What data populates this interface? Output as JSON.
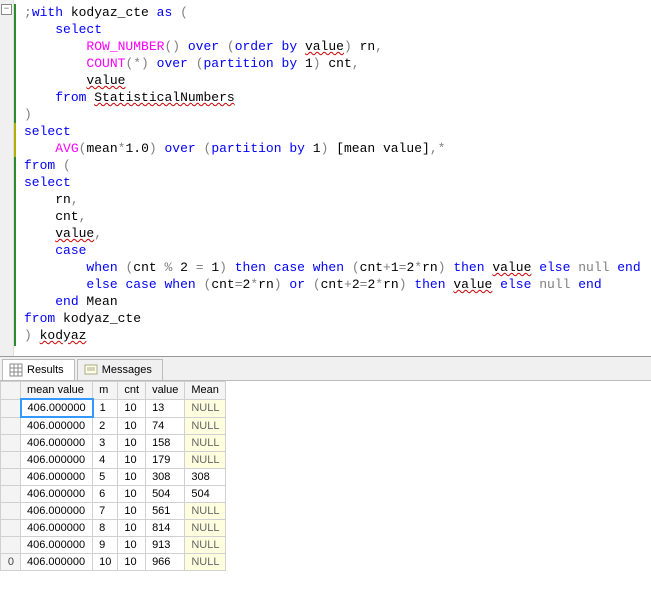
{
  "editor": {
    "lines": [
      [
        {
          "t": ";",
          "c": "grey"
        },
        {
          "t": "with",
          "c": "kw"
        },
        {
          "t": " kodyaz_cte ",
          "c": "ident"
        },
        {
          "t": "as",
          "c": "kw"
        },
        {
          "t": " ",
          "c": "ident"
        },
        {
          "t": "(",
          "c": "grey"
        }
      ],
      [
        {
          "t": "    ",
          "c": ""
        },
        {
          "t": "select",
          "c": "kw"
        }
      ],
      [
        {
          "t": "        ",
          "c": ""
        },
        {
          "t": "ROW_NUMBER",
          "c": "func"
        },
        {
          "t": "() ",
          "c": "grey"
        },
        {
          "t": "over",
          "c": "kw"
        },
        {
          "t": " ",
          "c": ""
        },
        {
          "t": "(",
          "c": "grey"
        },
        {
          "t": "order",
          "c": "kw"
        },
        {
          "t": " ",
          "c": ""
        },
        {
          "t": "by",
          "c": "kw"
        },
        {
          "t": " ",
          "c": ""
        },
        {
          "t": "value",
          "c": "ident squig"
        },
        {
          "t": ")",
          "c": "grey"
        },
        {
          "t": " rn",
          "c": "ident"
        },
        {
          "t": ",",
          "c": "grey"
        }
      ],
      [
        {
          "t": "        ",
          "c": ""
        },
        {
          "t": "COUNT",
          "c": "func"
        },
        {
          "t": "(*) ",
          "c": "grey"
        },
        {
          "t": "over",
          "c": "kw"
        },
        {
          "t": " ",
          "c": ""
        },
        {
          "t": "(",
          "c": "grey"
        },
        {
          "t": "partition",
          "c": "kw"
        },
        {
          "t": " ",
          "c": ""
        },
        {
          "t": "by",
          "c": "kw"
        },
        {
          "t": " 1",
          "c": "num"
        },
        {
          "t": ")",
          "c": "grey"
        },
        {
          "t": " cnt",
          "c": "ident"
        },
        {
          "t": ",",
          "c": "grey"
        }
      ],
      [
        {
          "t": "        ",
          "c": ""
        },
        {
          "t": "value",
          "c": "ident squig"
        }
      ],
      [
        {
          "t": "    ",
          "c": ""
        },
        {
          "t": "from",
          "c": "kw"
        },
        {
          "t": " ",
          "c": ""
        },
        {
          "t": "StatisticalNumbers",
          "c": "ident squig"
        }
      ],
      [
        {
          "t": ")",
          "c": "grey"
        }
      ],
      [
        {
          "t": "select",
          "c": "kw"
        }
      ],
      [
        {
          "t": "    ",
          "c": ""
        },
        {
          "t": "AVG",
          "c": "func"
        },
        {
          "t": "(",
          "c": "grey"
        },
        {
          "t": "mean",
          "c": "ident"
        },
        {
          "t": "*",
          "c": "grey"
        },
        {
          "t": "1.0",
          "c": "num"
        },
        {
          "t": ") ",
          "c": "grey"
        },
        {
          "t": "over",
          "c": "kw"
        },
        {
          "t": " ",
          "c": ""
        },
        {
          "t": "(",
          "c": "grey"
        },
        {
          "t": "partition",
          "c": "kw"
        },
        {
          "t": " ",
          "c": ""
        },
        {
          "t": "by",
          "c": "kw"
        },
        {
          "t": " 1",
          "c": "num"
        },
        {
          "t": ")",
          "c": "grey"
        },
        {
          "t": " [mean value]",
          "c": "ident"
        },
        {
          "t": ",*",
          "c": "grey"
        }
      ],
      [
        {
          "t": "from",
          "c": "kw"
        },
        {
          "t": " ",
          "c": ""
        },
        {
          "t": "(",
          "c": "grey"
        }
      ],
      [
        {
          "t": "select",
          "c": "kw"
        }
      ],
      [
        {
          "t": "    rn",
          "c": "ident"
        },
        {
          "t": ",",
          "c": "grey"
        }
      ],
      [
        {
          "t": "    cnt",
          "c": "ident"
        },
        {
          "t": ",",
          "c": "grey"
        }
      ],
      [
        {
          "t": "    ",
          "c": ""
        },
        {
          "t": "value",
          "c": "ident squig"
        },
        {
          "t": ",",
          "c": "grey"
        }
      ],
      [
        {
          "t": "    ",
          "c": ""
        },
        {
          "t": "case",
          "c": "kw"
        }
      ],
      [
        {
          "t": "        ",
          "c": ""
        },
        {
          "t": "when",
          "c": "kw"
        },
        {
          "t": " ",
          "c": ""
        },
        {
          "t": "(",
          "c": "grey"
        },
        {
          "t": "cnt ",
          "c": "ident"
        },
        {
          "t": "%",
          "c": "grey"
        },
        {
          "t": " 2 ",
          "c": "num"
        },
        {
          "t": "=",
          "c": "grey"
        },
        {
          "t": " 1",
          "c": "num"
        },
        {
          "t": ") ",
          "c": "grey"
        },
        {
          "t": "then",
          "c": "kw"
        },
        {
          "t": " ",
          "c": ""
        },
        {
          "t": "case",
          "c": "kw"
        },
        {
          "t": " ",
          "c": ""
        },
        {
          "t": "when",
          "c": "kw"
        },
        {
          "t": " ",
          "c": ""
        },
        {
          "t": "(",
          "c": "grey"
        },
        {
          "t": "cnt",
          "c": "ident"
        },
        {
          "t": "+",
          "c": "grey"
        },
        {
          "t": "1",
          "c": "num"
        },
        {
          "t": "=",
          "c": "grey"
        },
        {
          "t": "2",
          "c": "num"
        },
        {
          "t": "*",
          "c": "grey"
        },
        {
          "t": "rn",
          "c": "ident"
        },
        {
          "t": ") ",
          "c": "grey"
        },
        {
          "t": "then",
          "c": "kw"
        },
        {
          "t": " ",
          "c": ""
        },
        {
          "t": "value",
          "c": "ident squig"
        },
        {
          "t": " ",
          "c": ""
        },
        {
          "t": "else",
          "c": "kw"
        },
        {
          "t": " ",
          "c": ""
        },
        {
          "t": "null",
          "c": "grey"
        },
        {
          "t": " ",
          "c": ""
        },
        {
          "t": "end",
          "c": "kw"
        }
      ],
      [
        {
          "t": "        ",
          "c": ""
        },
        {
          "t": "else",
          "c": "kw"
        },
        {
          "t": " ",
          "c": ""
        },
        {
          "t": "case",
          "c": "kw"
        },
        {
          "t": " ",
          "c": ""
        },
        {
          "t": "when",
          "c": "kw"
        },
        {
          "t": " ",
          "c": ""
        },
        {
          "t": "(",
          "c": "grey"
        },
        {
          "t": "cnt",
          "c": "ident"
        },
        {
          "t": "=",
          "c": "grey"
        },
        {
          "t": "2",
          "c": "num"
        },
        {
          "t": "*",
          "c": "grey"
        },
        {
          "t": "rn",
          "c": "ident"
        },
        {
          "t": ") ",
          "c": "grey"
        },
        {
          "t": "or",
          "c": "kw"
        },
        {
          "t": " ",
          "c": ""
        },
        {
          "t": "(",
          "c": "grey"
        },
        {
          "t": "cnt",
          "c": "ident"
        },
        {
          "t": "+",
          "c": "grey"
        },
        {
          "t": "2",
          "c": "num"
        },
        {
          "t": "=",
          "c": "grey"
        },
        {
          "t": "2",
          "c": "num"
        },
        {
          "t": "*",
          "c": "grey"
        },
        {
          "t": "rn",
          "c": "ident"
        },
        {
          "t": ") ",
          "c": "grey"
        },
        {
          "t": "then",
          "c": "kw"
        },
        {
          "t": " ",
          "c": ""
        },
        {
          "t": "value",
          "c": "ident squig"
        },
        {
          "t": " ",
          "c": ""
        },
        {
          "t": "else",
          "c": "kw"
        },
        {
          "t": " ",
          "c": ""
        },
        {
          "t": "null",
          "c": "grey"
        },
        {
          "t": " ",
          "c": ""
        },
        {
          "t": "end",
          "c": "kw"
        }
      ],
      [
        {
          "t": "    ",
          "c": ""
        },
        {
          "t": "end",
          "c": "kw"
        },
        {
          "t": " Mean",
          "c": "ident"
        }
      ],
      [
        {
          "t": "from",
          "c": "kw"
        },
        {
          "t": " kodyaz_cte",
          "c": "ident"
        }
      ],
      [
        {
          "t": ") ",
          "c": "grey"
        },
        {
          "t": "kodyaz",
          "c": "ident squig"
        }
      ]
    ],
    "fold_symbol": "−"
  },
  "tabs": {
    "results": "Results",
    "messages": "Messages"
  },
  "grid": {
    "columns": [
      "mean value",
      "m",
      "cnt",
      "value",
      "Mean"
    ],
    "rows": [
      {
        "n": "",
        "mv": "406.000000",
        "m": "1",
        "cnt": "10",
        "val": "13",
        "mean": "NULL"
      },
      {
        "n": "",
        "mv": "406.000000",
        "m": "2",
        "cnt": "10",
        "val": "74",
        "mean": "NULL"
      },
      {
        "n": "",
        "mv": "406.000000",
        "m": "3",
        "cnt": "10",
        "val": "158",
        "mean": "NULL"
      },
      {
        "n": "",
        "mv": "406.000000",
        "m": "4",
        "cnt": "10",
        "val": "179",
        "mean": "NULL"
      },
      {
        "n": "",
        "mv": "406.000000",
        "m": "5",
        "cnt": "10",
        "val": "308",
        "mean": "308"
      },
      {
        "n": "",
        "mv": "406.000000",
        "m": "6",
        "cnt": "10",
        "val": "504",
        "mean": "504"
      },
      {
        "n": "",
        "mv": "406.000000",
        "m": "7",
        "cnt": "10",
        "val": "561",
        "mean": "NULL"
      },
      {
        "n": "",
        "mv": "406.000000",
        "m": "8",
        "cnt": "10",
        "val": "814",
        "mean": "NULL"
      },
      {
        "n": "",
        "mv": "406.000000",
        "m": "9",
        "cnt": "10",
        "val": "913",
        "mean": "NULL"
      },
      {
        "n": "0",
        "mv": "406.000000",
        "m": "10",
        "cnt": "10",
        "val": "966",
        "mean": "NULL"
      }
    ]
  }
}
